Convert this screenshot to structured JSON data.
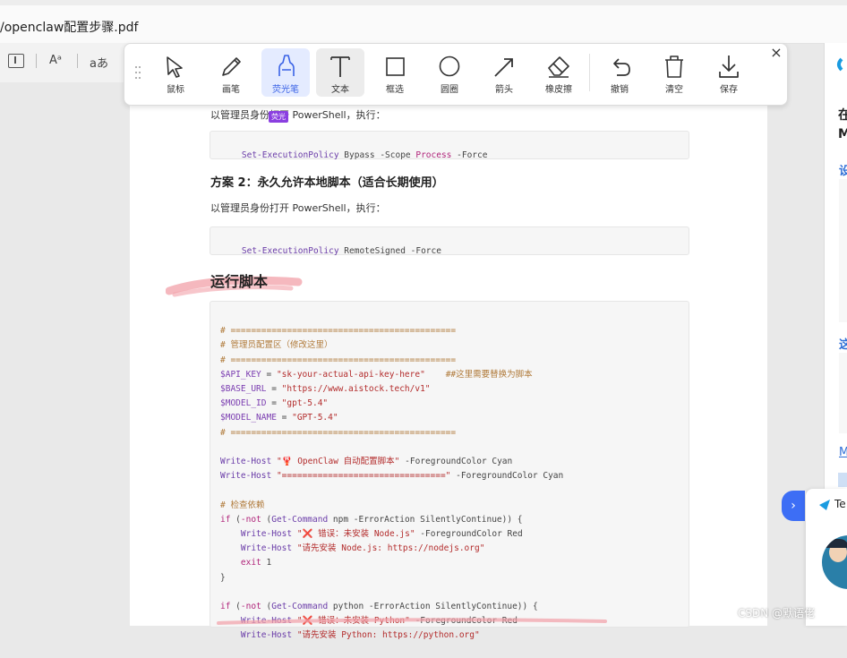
{
  "window": {
    "title": "/openclaw配置步骤.pdf"
  },
  "left_tools": {
    "read_mode": "A",
    "font_size": "Aᵃ",
    "translate": "aあ"
  },
  "toolbar": {
    "tools": [
      {
        "label": "鼠标",
        "icon": "cursor-icon"
      },
      {
        "label": "画笔",
        "icon": "pencil-icon"
      },
      {
        "label": "荧光笔",
        "icon": "highlighter-icon"
      },
      {
        "label": "文本",
        "icon": "text-icon"
      },
      {
        "label": "框选",
        "icon": "rectangle-icon"
      },
      {
        "label": "圆圈",
        "icon": "circle-icon"
      },
      {
        "label": "箭头",
        "icon": "arrow-icon"
      },
      {
        "label": "橡皮擦",
        "icon": "eraser-icon"
      },
      {
        "label": "撤销",
        "icon": "undo-icon"
      },
      {
        "label": "清空",
        "icon": "trash-icon"
      },
      {
        "label": "保存",
        "icon": "download-icon"
      }
    ],
    "active": "荧光笔",
    "tooltip": "荧光",
    "close": "×"
  },
  "document": {
    "line1": "以管理员身份打开 PowerShell，执行：",
    "code1": {
      "cmd": "Set-ExecutionPolicy",
      "arg": " Bypass -Scope ",
      "kw": "Process",
      "rest": " -Force"
    },
    "section2": "方案 2：永久允许本地脚本（适合长期使用）",
    "line2": "以管理员身份打开 PowerShell，执行：",
    "code2": {
      "cmd": "Set-ExecutionPolicy",
      "rest": " RemoteSigned -Force"
    },
    "heading": "运行脚本",
    "script": {
      "sep": "# ============================================",
      "config_comment": "# 管理员配置区（修改这里）",
      "api_key_var": "$API_KEY",
      "api_key_val": "\"sk-your-actual-api-key-here\"",
      "api_key_note": "##这里需要替换为脚本",
      "base_url_var": "$BASE_URL",
      "base_url_val": "\"https://www.aistock.tech/v1\"",
      "model_id_var": "$MODEL_ID",
      "model_id_val": "\"gpt-5.4\"",
      "model_name_var": "$MODEL_NAME",
      "model_name_val": "\"GPT-5.4\"",
      "wh": "Write-Host",
      "wh1_str": "\"🦞 OpenClaw 自动配置脚本\"",
      "wh1_rest": " -ForegroundColor Cyan",
      "wh2_str": "\"================================\"",
      "wh2_rest": " -ForegroundColor Cyan",
      "check_comment": "# 检查依赖",
      "if": "if",
      "not": "-not",
      "getcmd": "Get-Command",
      "npm_args": " npm -ErrorAction SilentlyContinue)) {",
      "wh3_str": "\"❌ 错误：未安装 Node.js\"",
      "wh3_rest": " -ForegroundColor Red",
      "wh4_str": "\"请先安装 Node.js: https://nodejs.org\"",
      "exit": "exit",
      "exit_code": " 1",
      "close_brace": "}",
      "py_args": " python -ErrorAction SilentlyContinue)) {",
      "wh5_str": "\"❌ 错误：未安装 Python\"",
      "wh5_rest": " -ForegroundColor Red",
      "wh6_str": "\"请先安装 Python: https://python.org\""
    }
  },
  "right_panel": {
    "char1": "在",
    "char2": "M",
    "link1": "设",
    "link2": "这",
    "link3": "M",
    "chat_prefix": "Te"
  },
  "colors": {
    "highlight": "#f2a0a8",
    "accent": "#3d6ef5",
    "active_bg": "#e4ebff"
  },
  "watermark": "CSDN @默语佬"
}
